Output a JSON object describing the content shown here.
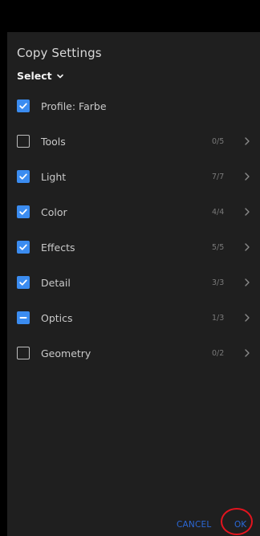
{
  "dialog": {
    "title": "Copy Settings",
    "select_label": "Select",
    "accent_color": "#3b8cf0",
    "background_color": "#1f1f1f"
  },
  "options": [
    {
      "label": "Profile: Farbe",
      "state": "checked",
      "count": "",
      "has_arrow": false
    },
    {
      "label": "Tools",
      "state": "unchecked",
      "count": "0/5",
      "has_arrow": true
    },
    {
      "label": "Light",
      "state": "checked",
      "count": "7/7",
      "has_arrow": true
    },
    {
      "label": "Color",
      "state": "checked",
      "count": "4/4",
      "has_arrow": true
    },
    {
      "label": "Effects",
      "state": "checked",
      "count": "5/5",
      "has_arrow": true
    },
    {
      "label": "Detail",
      "state": "checked",
      "count": "3/3",
      "has_arrow": true
    },
    {
      "label": "Optics",
      "state": "partial",
      "count": "1/3",
      "has_arrow": true
    },
    {
      "label": "Geometry",
      "state": "unchecked",
      "count": "0/2",
      "has_arrow": true
    }
  ],
  "footer": {
    "cancel_label": "CANCEL",
    "ok_label": "OK",
    "annotation_color": "#e3141e"
  }
}
